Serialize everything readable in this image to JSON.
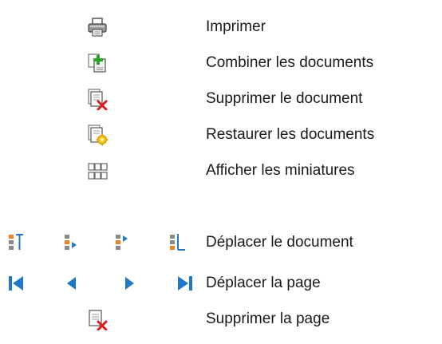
{
  "items": [
    {
      "label": "Imprimer",
      "icons": [
        "printer-icon"
      ]
    },
    {
      "label": "Combiner les documents",
      "icons": [
        "combine-documents-icon"
      ]
    },
    {
      "label": "Supprimer le document",
      "icons": [
        "delete-document-icon"
      ]
    },
    {
      "label": "Restaurer les documents",
      "icons": [
        "restore-documents-icon"
      ]
    },
    {
      "label": "Afficher les miniatures",
      "icons": [
        "thumbnails-icon"
      ]
    },
    {
      "label": "Déplacer le document",
      "icons": [
        "move-to-top-icon",
        "move-up-icon",
        "move-down-icon",
        "move-to-bottom-icon"
      ]
    },
    {
      "label": "Déplacer la page",
      "icons": [
        "first-page-icon",
        "previous-page-icon",
        "next-page-icon",
        "last-page-icon"
      ]
    },
    {
      "label": "Supprimer la page",
      "icons": [
        "delete-page-icon"
      ]
    }
  ],
  "colors": {
    "accent_blue": "#1f78c8",
    "delete_red": "#d81e1e",
    "add_green": "#2aa52a",
    "restore_yellow": "#f0b400",
    "icon_gray": "#8a8a8a",
    "text": "#1a1a1a"
  }
}
